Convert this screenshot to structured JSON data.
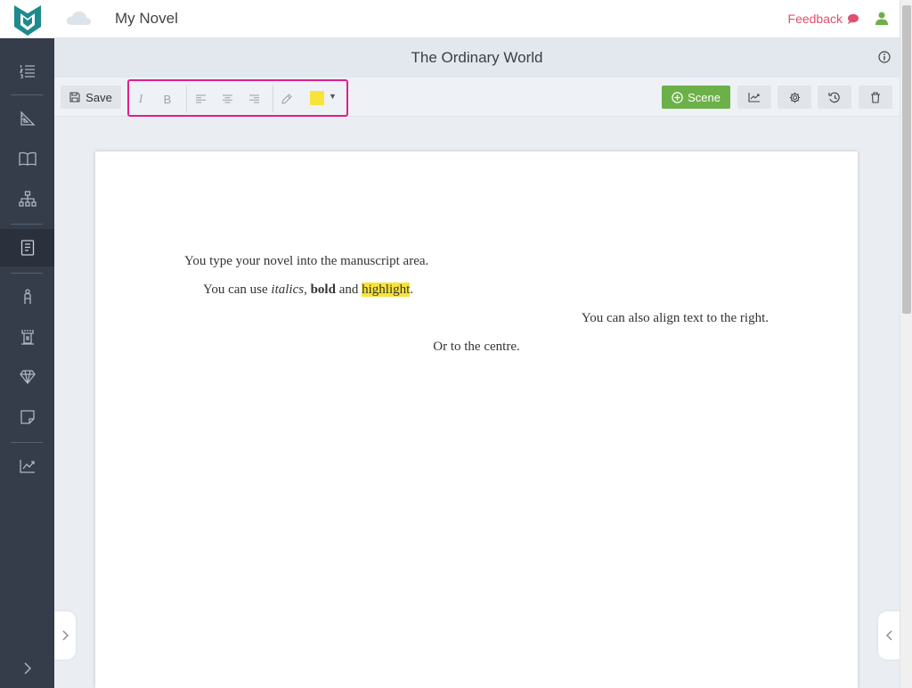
{
  "header": {
    "app_title": "My Novel",
    "feedback_label": "Feedback"
  },
  "document": {
    "title": "The Ordinary World"
  },
  "toolbar": {
    "save_label": "Save",
    "scene_label": "Scene",
    "highlight_color": "#f8e33a"
  },
  "manuscript": {
    "line1": "You type your novel into the manuscript area.",
    "line2": {
      "a": "You can use ",
      "italic": "italics",
      "b": ", ",
      "bold": "bold",
      "c": " and ",
      "highlight": "highlight",
      "d": "."
    },
    "line3": "You can also align text to the right.",
    "line4": "Or to the centre."
  },
  "colors": {
    "brand_teal": "#1f8a8c",
    "sidebar_bg": "#353d4a",
    "accent_green": "#6cb049",
    "feedback_pink": "#e0506e",
    "highlight_box": "#e01f8a"
  },
  "sidebar_icons": [
    "outline-icon",
    "ruler-icon",
    "book-icon",
    "hierarchy-icon",
    "manuscript-icon",
    "character-icon",
    "location-icon",
    "item-icon",
    "note-icon",
    "stats-icon"
  ]
}
